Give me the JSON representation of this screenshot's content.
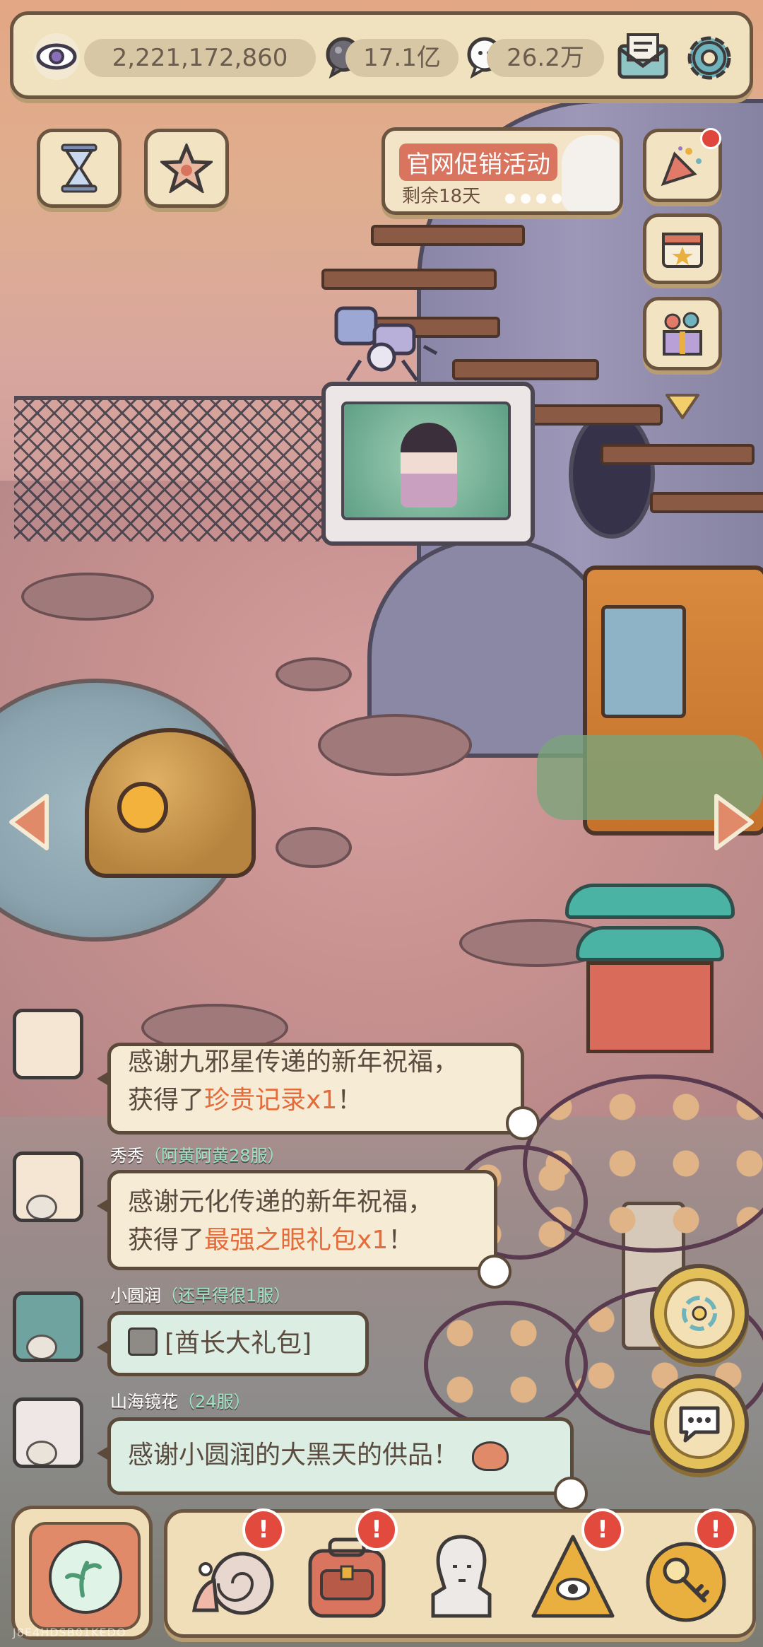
{
  "top_bar": {
    "eye_count": "2,221,172,860",
    "currency_1": "17.1亿",
    "currency_2": "26.2万"
  },
  "promo": {
    "title": "官网促销活动",
    "remaining": "剩余18天"
  },
  "chat": {
    "messages": [
      {
        "line1": "感谢九邪星传递的新年祝福，",
        "line2_prefix": "获得了",
        "item": "珍贵记录x1",
        "line2_suffix": "！"
      },
      {
        "user": "秀秀",
        "server": "（阿黄阿黄28服）",
        "line1": "感谢元化传递的新年祝福，",
        "line2_prefix": "获得了",
        "item": "最强之眼礼包x1",
        "line2_suffix": "！"
      },
      {
        "user": "小圆润",
        "server": "（还早得很1服）",
        "text": "[酋长大礼包]"
      },
      {
        "user": "山海镜花",
        "server": "（24服）",
        "text": "感谢小圆润的大黑天的供品！"
      }
    ]
  },
  "nav": {
    "badge": "!"
  },
  "watermark": "J8E4HDSB01KEDO",
  "colors": {
    "highlight": "#e56b3a",
    "badge_red": "#e14a3c",
    "panel": "#f0deb8",
    "border": "#6b5440"
  },
  "icons": [
    "eye-icon",
    "gear-icon",
    "mail-icon",
    "hourglass-icon",
    "star-icon",
    "party-popper-icon",
    "calendar-icon",
    "gift-icon",
    "chevron-down-icon",
    "left-arrow-icon",
    "right-arrow-icon",
    "swirl-icon",
    "chat-icon",
    "snail-icon",
    "backpack-icon",
    "statue-icon",
    "pyramid-eye-icon",
    "key-icon"
  ]
}
